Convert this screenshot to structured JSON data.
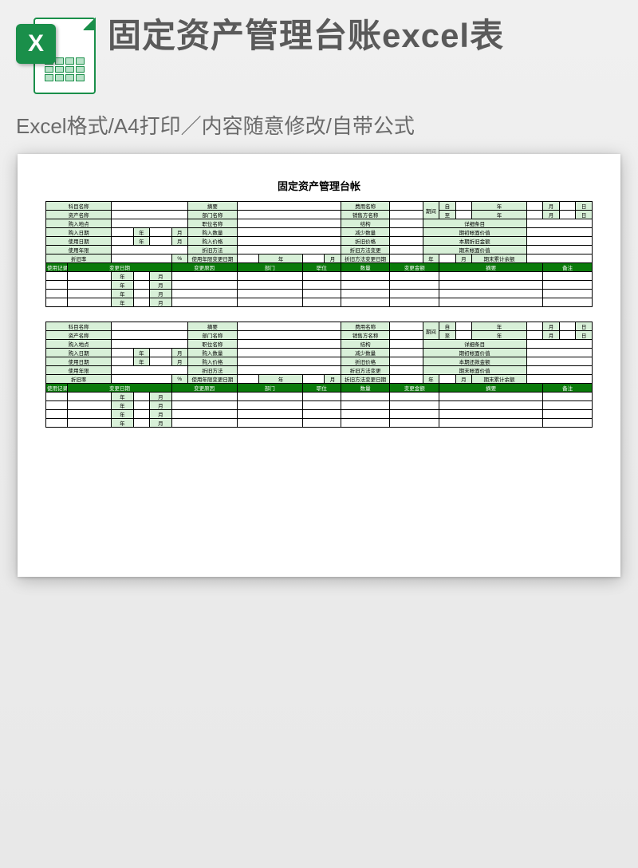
{
  "header": {
    "title": "固定资产管理台账excel表",
    "subtitle": "Excel格式/A4打印／内容随意修改/自带公式",
    "icon_letter": "X",
    "icon_name": "excel-icon"
  },
  "document": {
    "title": "固定资产管理台帐",
    "labels": {
      "subject_name": "科目名称",
      "summary": "摘要",
      "fee_name": "费用名称",
      "period": "期间",
      "from": "自",
      "to": "至",
      "year": "年",
      "month": "月",
      "day": "日",
      "asset_name": "资产名称",
      "dept_name": "部门名称",
      "seller_name": "销售方名称",
      "purchase_place": "购入地点",
      "position_name": "职位名称",
      "structure": "结构",
      "detail_item": "详细条目",
      "purchase_date": "购入日期",
      "purchase_qty": "购入数量",
      "reduce_qty": "减少数量",
      "begin_book_value": "期初帐面价值",
      "use_date": "使用日期",
      "purchase_price": "购入价格",
      "dep_price": "折旧价格",
      "period_dep_amount": "本期折旧金额",
      "period_repay_amount": "本期还款金额",
      "use_years": "使用年限",
      "dep_method": "折旧方法",
      "dep_method_change": "折旧方法变更",
      "end_book_value": "期末帐面价值",
      "dep_rate": "折旧率",
      "pct": "%",
      "use_years_change_date": "使用年限变更日期",
      "dep_method_change_date": "折旧方法变更日期",
      "end_cum_balance": "期末累计余额",
      "use_record": "使用记录",
      "change_date": "变更日期",
      "change_reason": "变更原因",
      "dept": "部门",
      "position": "职位",
      "qty": "数量",
      "change_amount": "变更金额",
      "summary2": "摘要",
      "remark": "备注"
    }
  }
}
